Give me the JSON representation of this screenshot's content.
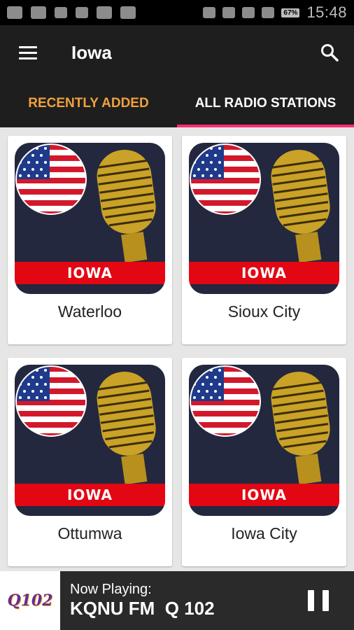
{
  "status_bar": {
    "time": "15:48",
    "battery": "67%"
  },
  "app_bar": {
    "title": "Iowa"
  },
  "tabs": [
    {
      "label": "RECENTLY ADDED",
      "active": false
    },
    {
      "label": "ALL RADIO STATIONS",
      "active": true
    }
  ],
  "cards": [
    {
      "name": "Waterloo",
      "banner": "IOWA"
    },
    {
      "name": "Sioux City",
      "banner": "IOWA"
    },
    {
      "name": "Ottumwa",
      "banner": "IOWA"
    },
    {
      "name": "Iowa City",
      "banner": "IOWA"
    }
  ],
  "player": {
    "logo_text": "Q102",
    "now_playing_label": "Now Playing:",
    "station": "KQNU FM  Q 102"
  },
  "colors": {
    "accent": "#ff2d6e",
    "inactive_tab": "#f2a03d",
    "banner": "#e30613",
    "art_bg": "#23283f"
  }
}
